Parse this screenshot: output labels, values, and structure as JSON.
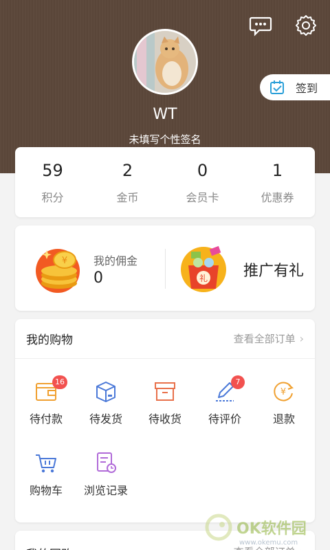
{
  "header": {
    "username": "WT",
    "signature": "未填写个性签名",
    "checkin_label": "签到"
  },
  "stats": [
    {
      "value": "59",
      "label": "积分"
    },
    {
      "value": "2",
      "label": "金币"
    },
    {
      "value": "0",
      "label": "会员卡"
    },
    {
      "value": "1",
      "label": "优惠券"
    }
  ],
  "promo": {
    "commission_label": "我的佣金",
    "commission_value": "0",
    "promote_label": "推广有礼"
  },
  "shopping": {
    "title": "我的购物",
    "view_all": "查看全部订单",
    "items": [
      {
        "label": "待付款",
        "badge": "16",
        "icon": "wallet-icon"
      },
      {
        "label": "待发货",
        "badge": null,
        "icon": "package-icon"
      },
      {
        "label": "待收货",
        "badge": null,
        "icon": "box-icon"
      },
      {
        "label": "待评价",
        "badge": "7",
        "icon": "pen-icon"
      },
      {
        "label": "退款",
        "badge": null,
        "icon": "yuan-refund-icon"
      },
      {
        "label": "购物车",
        "badge": null,
        "icon": "cart-icon"
      },
      {
        "label": "浏览记录",
        "badge": null,
        "icon": "history-icon"
      }
    ]
  },
  "group": {
    "title": "我的团购",
    "view_all": "查看全部订单"
  },
  "watermark": {
    "brand": "OK软件园",
    "url": "www.okemu.com"
  },
  "colors": {
    "header_brown": "#5e4a3d",
    "badge_red": "#f2514f",
    "orange": "#f0a030",
    "blue": "#4a78d8",
    "red_orange": "#e8704a",
    "purple": "#b06ad8"
  }
}
